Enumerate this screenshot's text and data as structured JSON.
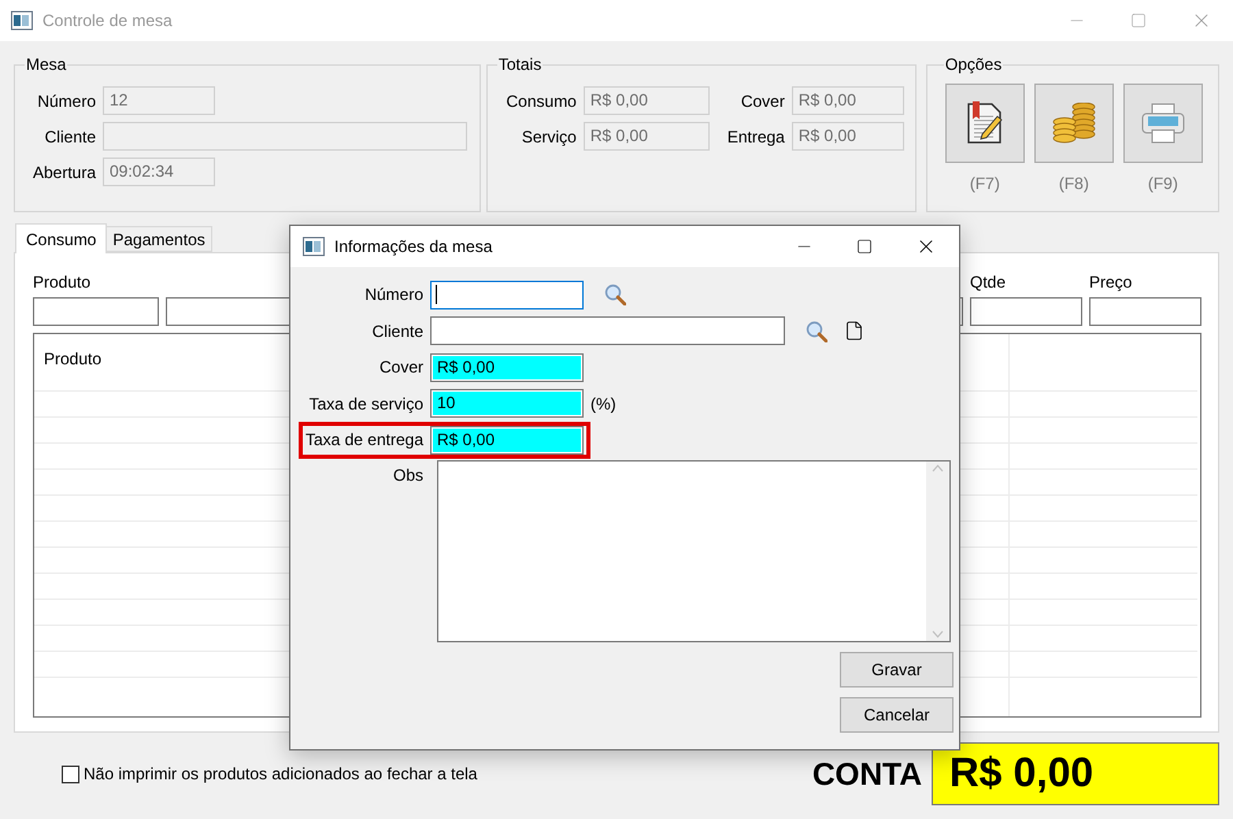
{
  "window": {
    "title": "Controle de mesa"
  },
  "mesa": {
    "title": "Mesa",
    "fields": [
      {
        "label": "Número",
        "value": "12",
        "wide": false
      },
      {
        "label": "Cliente",
        "wide": true
      },
      {
        "label": "Abertura",
        "value": "09:02:34",
        "wide": false
      }
    ]
  },
  "totais": {
    "title": "Totais",
    "fields": [
      {
        "label": "Consumo",
        "value": "R$ 0,00"
      },
      {
        "label": "Cover",
        "value": "R$ 0,00"
      },
      {
        "label": "Serviço",
        "value": "R$ 0,00"
      },
      {
        "label": "Entrega",
        "value": "R$ 0,00"
      }
    ]
  },
  "opcoes": {
    "title": "Opções",
    "buttons": [
      {
        "kind": "edit",
        "shortcut": "(F7)"
      },
      {
        "kind": "coins",
        "shortcut": "(F8)"
      },
      {
        "kind": "print",
        "shortcut": "(F9)"
      }
    ]
  },
  "tabs": [
    {
      "label": "Consumo",
      "selected": true
    },
    {
      "label": "Pagamentos",
      "selected": false
    }
  ],
  "consumo": {
    "product_label": "Produto",
    "qty_label": "Qtde",
    "price_label": "Preço",
    "grid_header": "Produto"
  },
  "option": {
    "label": "Não imprimir os produtos adicionados ao fechar a tela",
    "checked": false
  },
  "total": {
    "label": "CONTA",
    "value": "R$ 0,00"
  },
  "dialog": {
    "title": "Informações da mesa",
    "fields": [
      {
        "label": "Número",
        "kind": "search",
        "focused": true,
        "marked": false
      },
      {
        "label": "Cliente",
        "kind": "search_new",
        "focused": false,
        "marked": false
      },
      {
        "label": "Cover",
        "kind": "value",
        "value": "R$ 0,00",
        "focused": false,
        "marked": false
      },
      {
        "label": "Taxa de serviço",
        "kind": "value",
        "value": "10",
        "suffix": "(%)",
        "focused": false,
        "marked": false
      },
      {
        "label": "Taxa de entrega",
        "kind": "value",
        "value": "R$ 0,00",
        "focused": false,
        "marked": true
      }
    ],
    "obs_label": "Obs",
    "buttons": [
      "Gravar",
      "Cancelar"
    ]
  }
}
